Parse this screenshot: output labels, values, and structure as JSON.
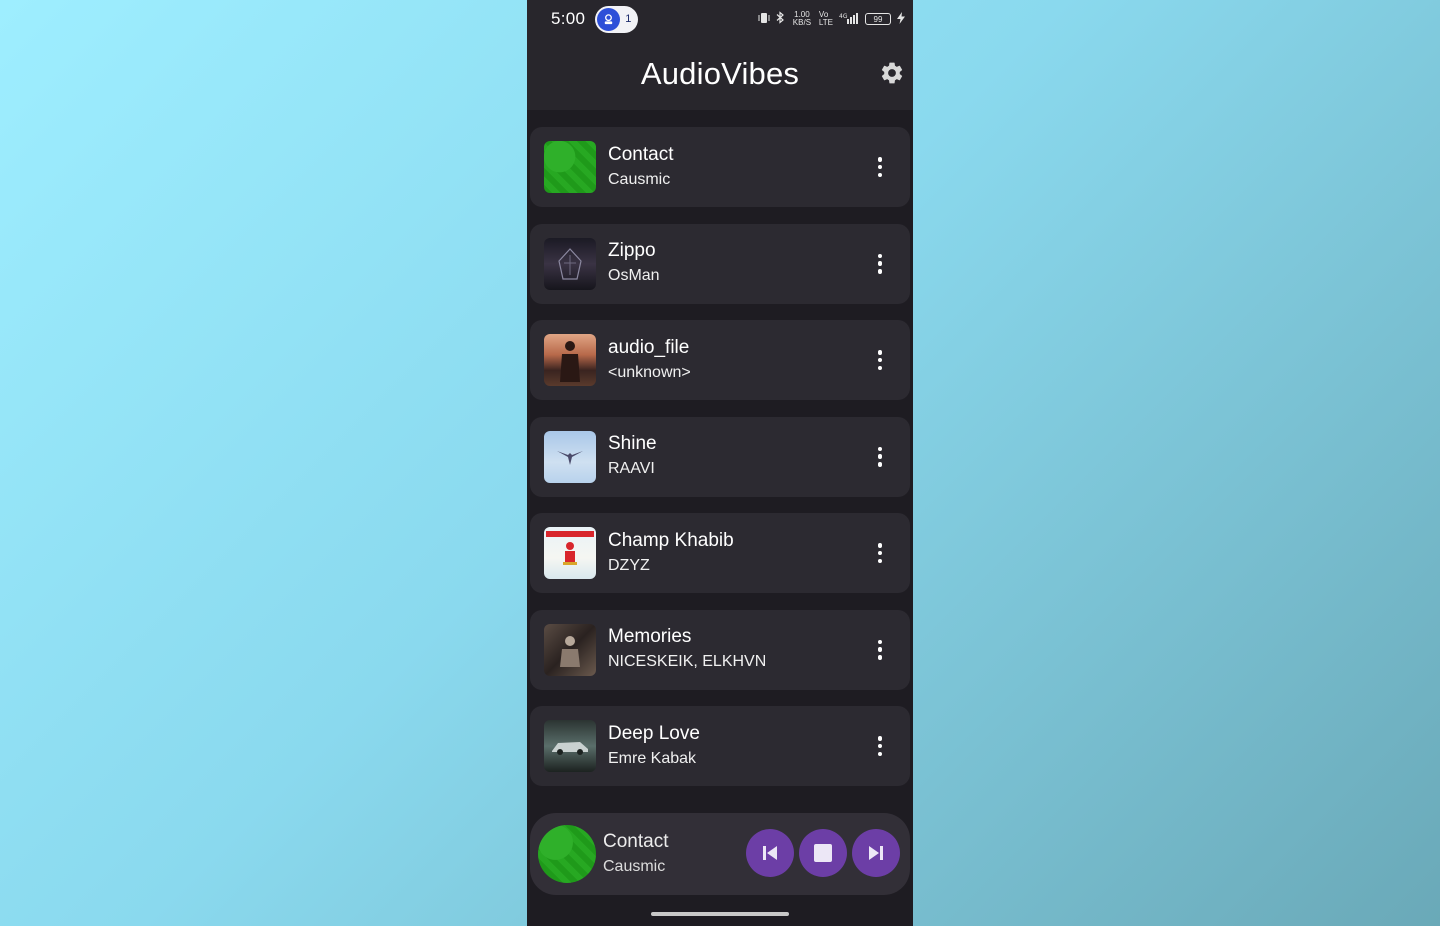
{
  "status_bar": {
    "time": "5:00",
    "notification_count": "1",
    "net_speed": "1.00 KB/S",
    "battery": "99",
    "icons": [
      "vibrate-icon",
      "bluetooth-icon",
      "volte-icon",
      "signal-icon",
      "charging-icon"
    ]
  },
  "app_bar": {
    "title": "AudioVibes",
    "settings_icon": "gear-icon"
  },
  "tracks": [
    {
      "title": "Contact",
      "artist": "Causmic",
      "art": "green"
    },
    {
      "title": "Zippo",
      "artist": "OsMan",
      "art": "dark"
    },
    {
      "title": "audio_file",
      "artist": "<unknown>",
      "art": "warrior"
    },
    {
      "title": "Shine",
      "artist": "RAAVI",
      "art": "sky"
    },
    {
      "title": "Champ Khabib",
      "artist": "DZYZ",
      "art": "champ"
    },
    {
      "title": "Memories",
      "artist": "NICESKEIK, ELKHVN",
      "art": "memo"
    },
    {
      "title": "Deep Love",
      "artist": "Emre Kabak",
      "art": "deep"
    }
  ],
  "now_playing": {
    "title": "Contact",
    "artist": "Causmic",
    "controls": [
      "skip-previous-icon",
      "stop-icon",
      "skip-next-icon"
    ]
  },
  "colors": {
    "background": "#1e1c22",
    "card": "#2c2a31",
    "accent": "#6c3ea6"
  }
}
